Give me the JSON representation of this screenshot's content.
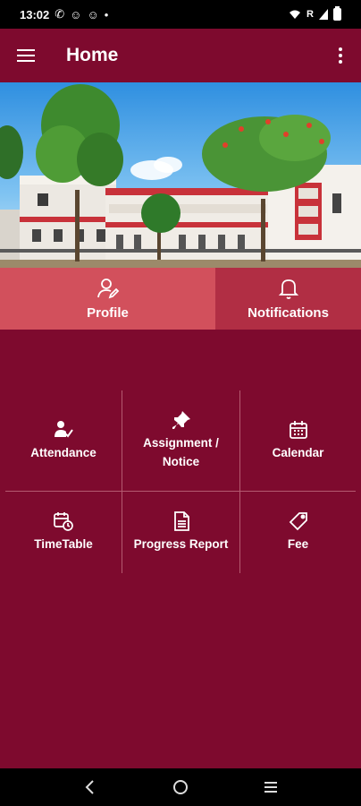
{
  "status_bar": {
    "time": "13:02",
    "network_label": "R",
    "icons": [
      "whatsapp-icon",
      "emoji-icon",
      "emoji-icon",
      "dot-icon",
      "wifi-icon",
      "signal-icon",
      "battery-icon"
    ]
  },
  "app_bar": {
    "title": "Home",
    "menu_icon": "hamburger-menu-icon",
    "overflow_icon": "more-vertical-icon"
  },
  "banner": {
    "description_icon": "school-building-image"
  },
  "tabs": [
    {
      "label": "Profile",
      "icon": "user-edit-icon",
      "selected": false
    },
    {
      "label": "Notifications",
      "icon": "bell-icon",
      "selected": true
    }
  ],
  "menu": [
    {
      "label": "Attendance",
      "icon": "user-check-icon"
    },
    {
      "label": "Assignment /",
      "label2": "Notice",
      "icon": "pushpin-icon"
    },
    {
      "label": "Calendar",
      "icon": "calendar-icon"
    },
    {
      "label": "TimeTable",
      "icon": "calendar-clock-icon"
    },
    {
      "label": "Progress Report",
      "icon": "document-icon"
    },
    {
      "label": "Fee",
      "icon": "tag-icon"
    }
  ],
  "colors": {
    "primary": "#7e0a2e",
    "tab_profile": "#d2505c",
    "tab_notifications": "#b12e44",
    "divider": "#b45a70"
  }
}
